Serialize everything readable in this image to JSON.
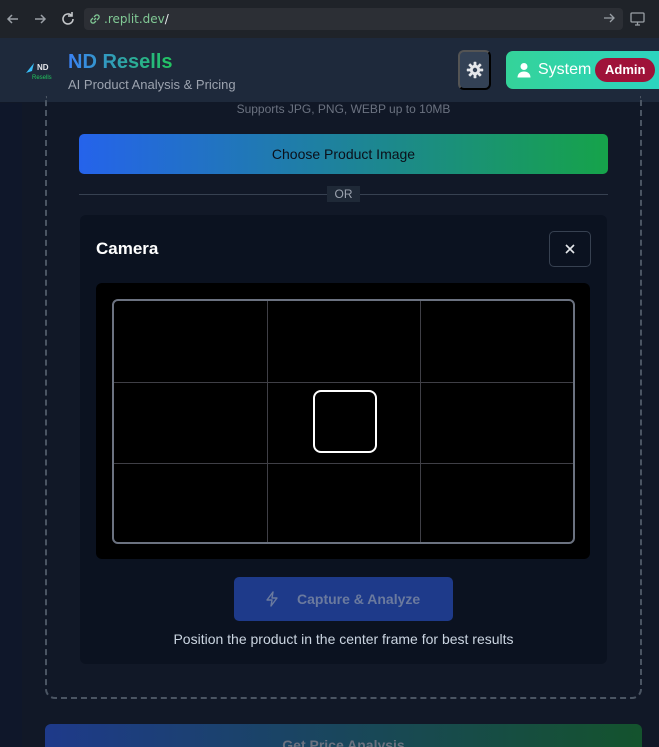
{
  "browser": {
    "url_prefix": ".replit.dev",
    "url_suffix": "/"
  },
  "header": {
    "logo_text_top": "ND",
    "logo_text_bottom": "Resells",
    "title": "ND Resells",
    "subtitle": "AI Product Analysis & Pricing",
    "user_label": "System",
    "role_badge": "Admin"
  },
  "upload": {
    "supports_text": "Supports JPG, PNG, WEBP up to 10MB",
    "choose_button": "Choose Product Image",
    "divider_text": "OR"
  },
  "camera": {
    "title": "Camera",
    "capture_button": "Capture & Analyze",
    "hint": "Position the product in the center frame for best results"
  },
  "footer": {
    "price_button": "Get Price Analysis"
  },
  "colors": {
    "brand_start": "#3b82f6",
    "brand_end": "#22c55e",
    "admin_badge": "#9f1239",
    "user_pill": "#34d399"
  }
}
